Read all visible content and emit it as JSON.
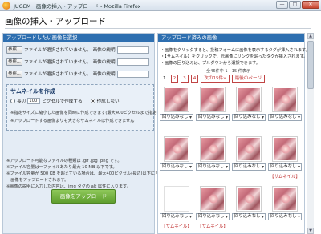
{
  "window": {
    "title": "JUGEM　画像の挿入・アップロード - Mozilla Firefox",
    "buttons": {
      "minimize": "—",
      "maximize": "□",
      "close": "✕"
    }
  },
  "page": {
    "title": "画像の挿入・アップロード"
  },
  "upload_panel": {
    "header": "アップロードしたい画像を選択",
    "browse_label": "参照...",
    "no_file_text": "ファイルが選択されていません。",
    "desc_label": "画像の説明",
    "rows": 3,
    "thumbnail": {
      "title": "サムネイルを作成",
      "long_side_label": "長辺",
      "size_value": "100",
      "pixel_text": "ピクセルで作成する",
      "no_create_label": "作成しない",
      "selected_option": "作成しない",
      "notes": [
        "※指定サイズに縮小した画像を同時に作成できます(最大400ピクセルまで指定可)。",
        "※アップロードする画像よりも大きなサムネイルは作成できません"
      ]
    },
    "notes": [
      "※アップロード可能なファイルの種類は .gif .jpg .png です。",
      "※ファイル容量は一ファイルあたり最大 10 MB 以下です。",
      "※ファイル容量が 500 KB を超えている場合は、最大400ピクセル(長辺)以下に自動的に縮小し",
      "　画像をアップロードされます。",
      "※画像の説明に入力した内容は、img タグの alt 属性に入ります。"
    ],
    "upload_button": "画像をアップロード"
  },
  "uploaded_panel": {
    "header": "アップロード済みの画像",
    "instructions": [
      "・画像をクリックすると、投稿フォームに画像を表示するタグが挿入されます。",
      "・【サムネイル】をクリックで、元画像にリンクを貼ったタグが挿入されます。",
      "・画像の回り込みは、プルダウンから選択できます。"
    ],
    "pager_info": "全46件中 1 - 15 件表示",
    "pages": [
      "1",
      "2",
      "3",
      "4"
    ],
    "current_page": "1",
    "next_label": "次の15件»",
    "last_label": "最後のページ",
    "wrap_option": "回り込みなし",
    "thumb_label": "【サムネイル】",
    "grid": [
      {
        "photo": true,
        "thumb": false
      },
      {
        "photo": true,
        "thumb": false
      },
      {
        "photo": true,
        "thumb": false
      },
      {
        "photo": true,
        "thumb": false
      },
      {
        "photo": true,
        "thumb": false
      },
      {
        "photo": true,
        "thumb": false
      },
      {
        "photo": true,
        "thumb": false
      },
      {
        "photo": true,
        "thumb": true
      },
      {
        "photo": false,
        "thumb": true
      },
      {
        "photo": true,
        "thumb": true
      },
      {
        "photo": true,
        "thumb": false
      },
      {
        "photo": true,
        "thumb": false
      }
    ]
  },
  "colors": {
    "header_blue": "#2e6fb0",
    "upload_green": "#6aae36",
    "pager_red": "#c03030"
  }
}
